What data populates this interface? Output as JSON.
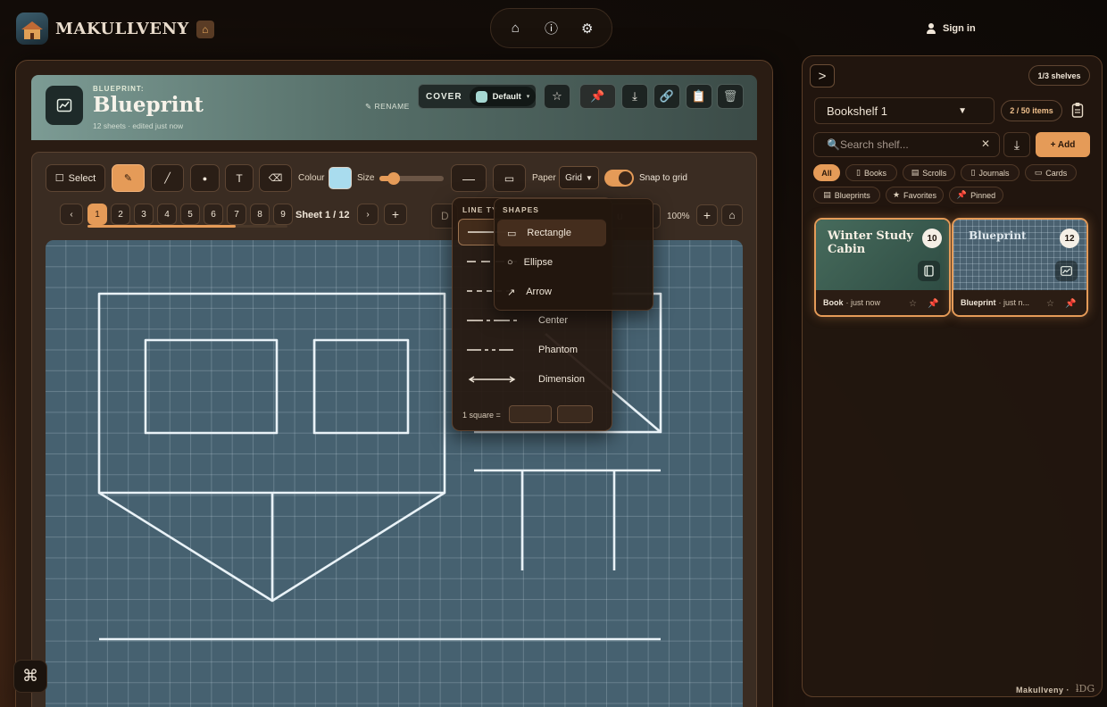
{
  "brand": {
    "name": "MAKULLVENY"
  },
  "topnav": {
    "home": "⌂",
    "info": "ⓘ",
    "settings": "⚙"
  },
  "auth": {
    "sign_in": "Sign in"
  },
  "document": {
    "kicker": "BLUEPRINT:",
    "title": "Blueprint",
    "meta": "12 sheets · edited just now",
    "rename": "RENAME",
    "cover_label": "COVER",
    "cover_value": "Default",
    "cover_color": "#a6d8d2"
  },
  "header_actions": [
    "☆",
    "📌",
    "⤓",
    "🔗",
    "📋",
    "🗑"
  ],
  "toolbar": {
    "select": "Select",
    "pen": "✎",
    "line": "╱",
    "dot": "●",
    "text": "T",
    "eraser": "⌫",
    "colour_label": "Colour",
    "colour_value": "#a9dcee",
    "size_label": "Size",
    "size_value": 0.22,
    "line_style": "—",
    "shape": "▭",
    "paper_label": "Paper",
    "paper_value": "Grid",
    "snap_label": "Snap to grid",
    "snap_on": true
  },
  "sheets": {
    "prev": "‹",
    "pages": [
      "1",
      "2",
      "3",
      "4",
      "5",
      "6",
      "7",
      "8",
      "9"
    ],
    "active": 1,
    "progress": 0.74,
    "label": "Sheet 1 / 12",
    "next": "›",
    "add": "+",
    "ghost_left": "D",
    "ghost_right": "u",
    "zoom": "100%",
    "zoom_in": "+",
    "fit": "⌂"
  },
  "line_types": {
    "heading": "LINE TY",
    "items": [
      "",
      "",
      "",
      "Center",
      "Phantom",
      "Dimension"
    ],
    "scale_label": "1 square ="
  },
  "shapes_menu": {
    "heading": "SHAPES",
    "items": [
      {
        "icon": "▭",
        "label": "Rectangle"
      },
      {
        "icon": "○",
        "label": "Ellipse"
      },
      {
        "icon": "↗",
        "label": "Arrow"
      }
    ]
  },
  "cmd": "⌘",
  "shelf": {
    "collapse": ">",
    "count": "1/3 shelves",
    "name": "Bookshelf 1",
    "items": "2 / 50 items",
    "search_placeholder": "🔍Search shelf...",
    "clear": "✕",
    "sort": "⤓",
    "add": "+ Add",
    "filters": [
      {
        "icon": "",
        "label": "All"
      },
      {
        "icon": "▯",
        "label": "Books"
      },
      {
        "icon": "▤",
        "label": "Scrolls"
      },
      {
        "icon": "▯",
        "label": "Journals"
      },
      {
        "icon": "▭",
        "label": "Cards"
      },
      {
        "icon": "▤",
        "label": "Blueprints"
      },
      {
        "icon": "★",
        "label": "Favorites"
      },
      {
        "icon": "📌",
        "label": "Pinned"
      }
    ],
    "cards": [
      {
        "title": "Winter Study Cabin",
        "count": "10",
        "type": "Book",
        "time": "· just now"
      },
      {
        "title": "Blueprint",
        "count": "12",
        "type": "Blueprint",
        "time": "· just n..."
      }
    ],
    "footer": "Makullveny ·",
    "footer_logo": "ƚDG"
  }
}
